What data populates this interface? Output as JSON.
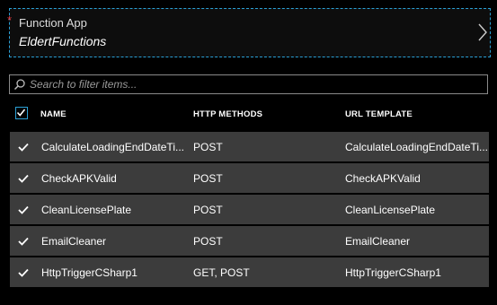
{
  "function_app": {
    "required_marker": "*",
    "label": "Function App",
    "value": "EldertFunctions"
  },
  "filter": {
    "placeholder": "Search to filter items..."
  },
  "table": {
    "columns": [
      "NAME",
      "HTTP METHODS",
      "URL TEMPLATE"
    ],
    "all_selected": true,
    "rows": [
      {
        "name": "CalculateLoadingEndDateTi...",
        "methods": "POST",
        "url": "CalculateLoadingEndDateTi...",
        "selected": true
      },
      {
        "name": "CheckAPKValid",
        "methods": "POST",
        "url": "CheckAPKValid",
        "selected": true
      },
      {
        "name": "CleanLicensePlate",
        "methods": "POST",
        "url": "CleanLicensePlate",
        "selected": true
      },
      {
        "name": "EmailCleaner",
        "methods": "POST",
        "url": "EmailCleaner",
        "selected": true
      },
      {
        "name": "HttpTriggerCSharp1",
        "methods": "GET, POST",
        "url": "HttpTriggerCSharp1",
        "selected": true
      }
    ]
  },
  "colors": {
    "accent": "#2aa0d6",
    "required": "#e0393e",
    "row_background": "#3c3c3c"
  },
  "icons": {
    "picker_chevron": "chevron-right-icon",
    "filter": "search-icon",
    "checkbox": "check-icon"
  }
}
